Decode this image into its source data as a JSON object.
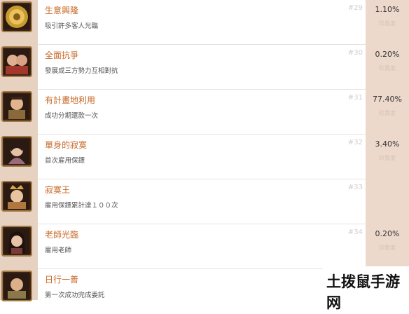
{
  "achievements": [
    {
      "title": "生意興隆",
      "desc": "吸引許多客人光臨",
      "num": "#29",
      "pct": "1.10%",
      "pct_label": "珍貴度",
      "icon": "gold-coins-icon",
      "tone": "#c99a2e"
    },
    {
      "title": "全面抗爭",
      "desc": "發展成三方勢力互相對抗",
      "num": "#30",
      "pct": "0.20%",
      "pct_label": "珍貴度",
      "icon": "warriors-portrait-icon",
      "tone": "#a3372c"
    },
    {
      "title": "有計畫地利用",
      "desc": "成功分期還款一次",
      "num": "#31",
      "pct": "77.40%",
      "pct_label": "珍貴度",
      "icon": "merchant-portrait-icon",
      "tone": "#8a6a3a"
    },
    {
      "title": "單身的寂寞",
      "desc": "首次雇用保鏢",
      "num": "#32",
      "pct": "3.40%",
      "pct_label": "珍貴度",
      "icon": "lady-portrait-icon",
      "tone": "#9a6a7a"
    },
    {
      "title": "寂寞王",
      "desc": "雇用保鏢累計達１００次",
      "num": "#33",
      "pct": "",
      "pct_label": "",
      "icon": "crowned-figure-icon",
      "tone": "#b0783e"
    },
    {
      "title": "老師光臨",
      "desc": "雇用老師",
      "num": "#34",
      "pct": "0.20%",
      "pct_label": "珍貴度",
      "icon": "teacher-portrait-icon",
      "tone": "#7a3a3a"
    },
    {
      "title": "日行一善",
      "desc": "第一次成功完成委託",
      "num": "",
      "pct": "",
      "pct_label": "",
      "icon": "monk-portrait-icon",
      "tone": "#8a7a4a"
    }
  ],
  "watermark": "土拨鼠手游网"
}
